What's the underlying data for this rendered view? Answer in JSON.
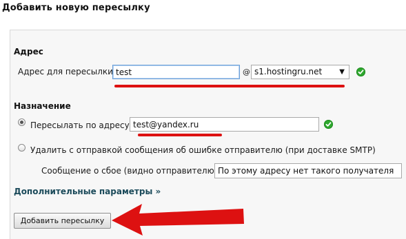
{
  "page": {
    "title": "Добавить новую пересылку"
  },
  "address_section": {
    "heading": "Адрес",
    "forward_label": "Адрес для пересылки:",
    "forward_value": "test",
    "at_sign": "@",
    "domain_selected": "s1.hostingru.net",
    "domain_status": "valid"
  },
  "destination_section": {
    "heading": "Назначение",
    "option_forward_label": "Пересылать по адресу:",
    "option_forward_value": "test@yandex.ru",
    "option_forward_checked": true,
    "forward_status": "valid",
    "option_fail_label": "Удалить с отправкой сообщения об ошибке отправителю (при доставке SMTP)",
    "option_fail_checked": false,
    "fail_message_label": "Сообщение о сбое (видно отправителю):",
    "fail_message_value": "По этому адресу нет такого получателя"
  },
  "advanced_link": "Дополнительные параметры »",
  "submit_label": "Добавить пересылку",
  "colors": {
    "annotation_red": "#dd1111",
    "valid_green": "#2fa82f",
    "link": "#1b4a5a"
  },
  "icons": {
    "valid": "check-circle-icon",
    "dropdown": "triangle-down-icon",
    "pointer": "red-arrow-annotation"
  }
}
